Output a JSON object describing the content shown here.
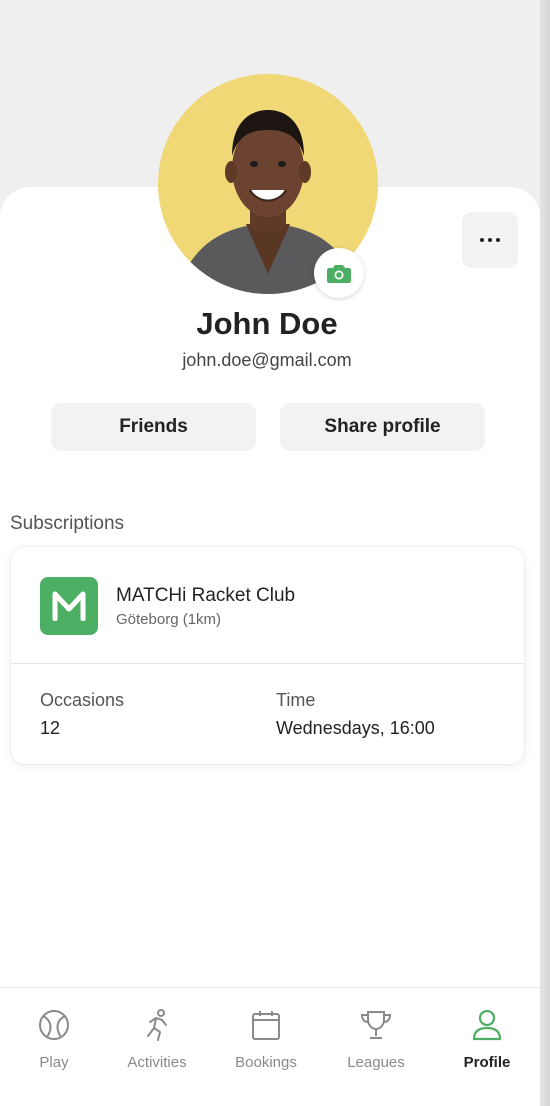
{
  "profile": {
    "name": "John Doe",
    "email": "john.doe@gmail.com"
  },
  "actions": {
    "friends_label": "Friends",
    "share_label": "Share profile"
  },
  "subscriptions": {
    "title": "Subscriptions",
    "items": [
      {
        "club_logo_letter": "M",
        "club_name": "MATCHi Racket Club",
        "location": "Göteborg (1km)",
        "occasions_label": "Occasions",
        "occasions_value": "12",
        "time_label": "Time",
        "time_value": "Wednesdays, 16:00"
      }
    ]
  },
  "nav": {
    "items": [
      {
        "label": "Play",
        "icon": "tennis-ball-icon",
        "active": false
      },
      {
        "label": "Activities",
        "icon": "running-person-icon",
        "active": false
      },
      {
        "label": "Bookings",
        "icon": "calendar-icon",
        "active": false
      },
      {
        "label": "Leagues",
        "icon": "trophy-icon",
        "active": false
      },
      {
        "label": "Profile",
        "icon": "user-icon",
        "active": true
      }
    ]
  },
  "colors": {
    "accent_green": "#4caf63",
    "avatar_background": "#f0d876",
    "header_background": "#efefef",
    "button_background": "#f1f2f2"
  }
}
